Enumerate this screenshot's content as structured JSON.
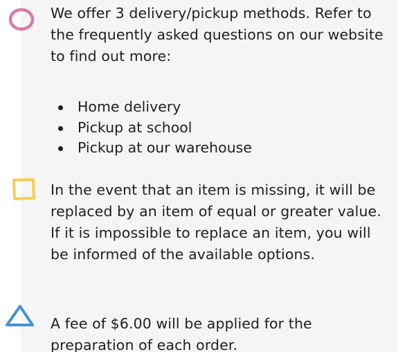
{
  "colors": {
    "panel_background": "#f5f5f5",
    "circle": "#d97aa8",
    "square": "#f2cf4e",
    "triangle": "#3f92d4",
    "text": "#1f1f1f"
  },
  "sections": [
    {
      "icon": "circle-icon",
      "text": "We offer 3 delivery/pickup methods. Refer to the frequently asked questions on our website to find out more:",
      "list": [
        "Home delivery",
        "Pickup at school",
        "Pickup at our warehouse"
      ]
    },
    {
      "icon": "square-icon",
      "text": "In the event that an item is missing, it will be replaced by an item of equal or greater value. If it is impossible to replace an item, you will be informed of the available options."
    },
    {
      "icon": "triangle-icon",
      "text": "A fee of $6.00 will be applied for the preparation of each order."
    }
  ]
}
